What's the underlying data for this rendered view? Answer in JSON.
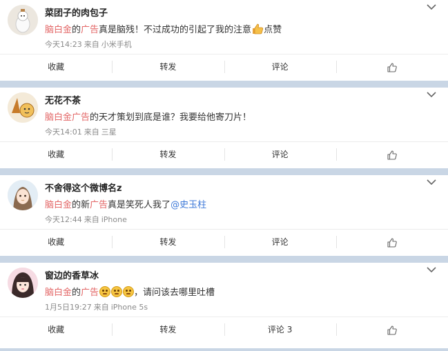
{
  "posts": [
    {
      "username": "菜团子的肉包子",
      "segments": [
        {
          "text": "脑白金",
          "style": "red"
        },
        {
          "text": "的",
          "style": "plain"
        },
        {
          "text": "广告",
          "style": "red"
        },
        {
          "text": "真是脑残！不过成功的引起了我的注意",
          "style": "plain"
        }
      ],
      "trailing_text": "点赞",
      "time": "今天14:23",
      "source_prefix": "来自",
      "device": "小米手机",
      "actions": {
        "favorite": "收藏",
        "repost": "转发",
        "comment": "评论"
      }
    },
    {
      "username": "无花不茶",
      "segments": [
        {
          "text": "脑白金",
          "style": "red"
        },
        {
          "text": "广告",
          "style": "red"
        },
        {
          "text": "的天才策划到底是谁？我要给他寄刀片！",
          "style": "plain"
        }
      ],
      "time": "今天14:01",
      "source_prefix": "来自",
      "device": "三星",
      "actions": {
        "favorite": "收藏",
        "repost": "转发",
        "comment": "评论"
      }
    },
    {
      "username": "不舍得这个微博名z",
      "segments": [
        {
          "text": "脑白金",
          "style": "red"
        },
        {
          "text": "的新",
          "style": "plain"
        },
        {
          "text": "广告",
          "style": "red"
        },
        {
          "text": "真是笑死人我了",
          "style": "plain"
        },
        {
          "text": "@史玉柱",
          "style": "blue"
        }
      ],
      "time": "今天12:44",
      "source_prefix": "来自",
      "device": "iPhone",
      "actions": {
        "favorite": "收藏",
        "repost": "转发",
        "comment": "评论"
      }
    },
    {
      "username": "窗边的香草冰",
      "segments": [
        {
          "text": "脑白金",
          "style": "red"
        },
        {
          "text": "的",
          "style": "plain"
        },
        {
          "text": "广告",
          "style": "red"
        }
      ],
      "trailing_text": "，请问该去哪里吐槽",
      "time": "1月5日19:27",
      "source_prefix": "来自",
      "device": "iPhone 5s",
      "actions": {
        "favorite": "收藏",
        "repost": "转发",
        "comment": "评论 3"
      }
    }
  ],
  "colors": {
    "highlight": "#e36666",
    "mention": "#3c78d8",
    "separator": "#c9d6e5"
  },
  "icons": [
    "thumbs-up-icon",
    "chevron-down-icon",
    "emoji-icon"
  ]
}
